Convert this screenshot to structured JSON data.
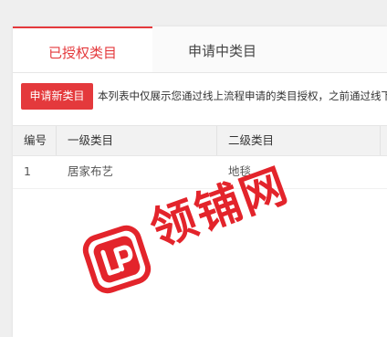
{
  "tabs": [
    {
      "label": "已授权类目",
      "active": true
    },
    {
      "label": "申请中类目",
      "active": false
    }
  ],
  "toolbar": {
    "apply_label": "申请新类目",
    "notice": "本列表中仅展示您通过线上流程申请的类目授权，之前通过线下"
  },
  "table": {
    "columns": [
      "编号",
      "一级类目",
      "二级类目"
    ],
    "rows": [
      {
        "id": "1",
        "level1": "居家布艺",
        "level2": "地毯"
      }
    ]
  },
  "watermark": {
    "text": "领铺网"
  },
  "colors": {
    "accent": "#e4393c",
    "header_bg": "#f2f2f2"
  }
}
